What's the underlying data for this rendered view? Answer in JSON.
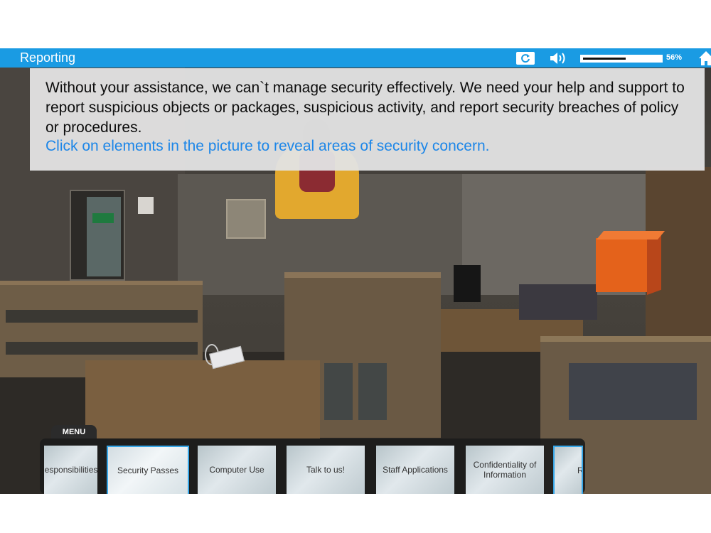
{
  "header": {
    "title": "Reporting",
    "progress_percent": 56,
    "progress_label": "56%",
    "replay_icon": "replay-icon",
    "audio_icon": "speaker-icon",
    "home_icon": "home-icon",
    "accent_color": "#1a9be3"
  },
  "info": {
    "text": "Without your assistance, we can`t manage security effectively. We need your help and support to report suspicious objects or packages, suspicious activity, and report security breaches of policy or procedures.",
    "instruction": "Click on elements in the picture to reveal areas of security concern."
  },
  "menu": {
    "label": "MENU",
    "items": [
      {
        "label": "Responsibilities"
      },
      {
        "label": "Security Passes",
        "active": true
      },
      {
        "label": "Computer Use"
      },
      {
        "label": "Talk to us!"
      },
      {
        "label": "Staff Applications"
      },
      {
        "label": "Confidentiality of Information"
      },
      {
        "label": "R"
      }
    ]
  }
}
